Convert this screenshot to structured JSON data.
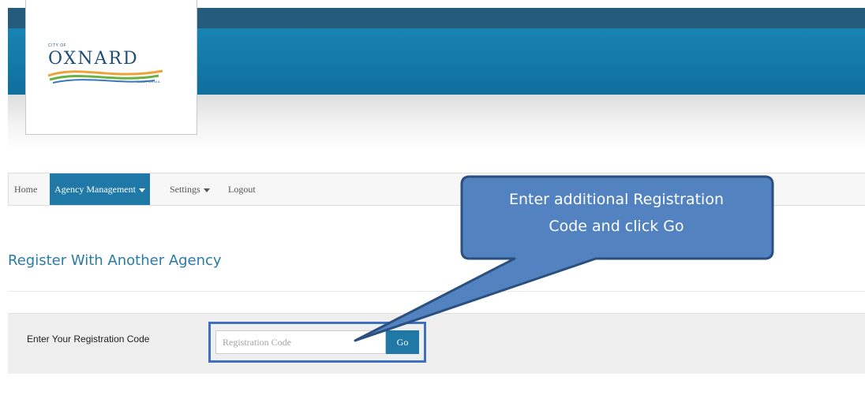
{
  "header": {
    "logo": {
      "city_of": "CITY OF",
      "name": "OXNARD",
      "state": "CALIFORNIA",
      "colors": {
        "wordmark": "#1f4d78",
        "swoosh_orange": "#f0a13a",
        "swoosh_green": "#6bb244",
        "swoosh_blue": "#3a79b9"
      }
    }
  },
  "nav": {
    "items": [
      {
        "label": "Home",
        "active": false,
        "has_caret": false
      },
      {
        "label": "Agency Management",
        "active": true,
        "has_caret": true
      },
      {
        "label": "Settings",
        "active": false,
        "has_caret": true
      },
      {
        "label": "Logout",
        "active": false,
        "has_caret": false
      }
    ]
  },
  "page": {
    "title": "Register With Another Agency"
  },
  "form": {
    "label": "Enter Your Registration Code",
    "input": {
      "value": "",
      "placeholder": "Registration Code"
    },
    "go_label": "Go"
  },
  "callout": {
    "line1": "Enter additional Registration",
    "line2": "Code and click Go"
  },
  "colors": {
    "accent": "#1f78a6",
    "title": "#2a7aa6",
    "header_dark": "#255c7c",
    "header_blue": "#1984b4",
    "callout_fill": "#5282c0",
    "callout_border": "#2b4f7e",
    "highlight_border": "#3f70bf"
  }
}
